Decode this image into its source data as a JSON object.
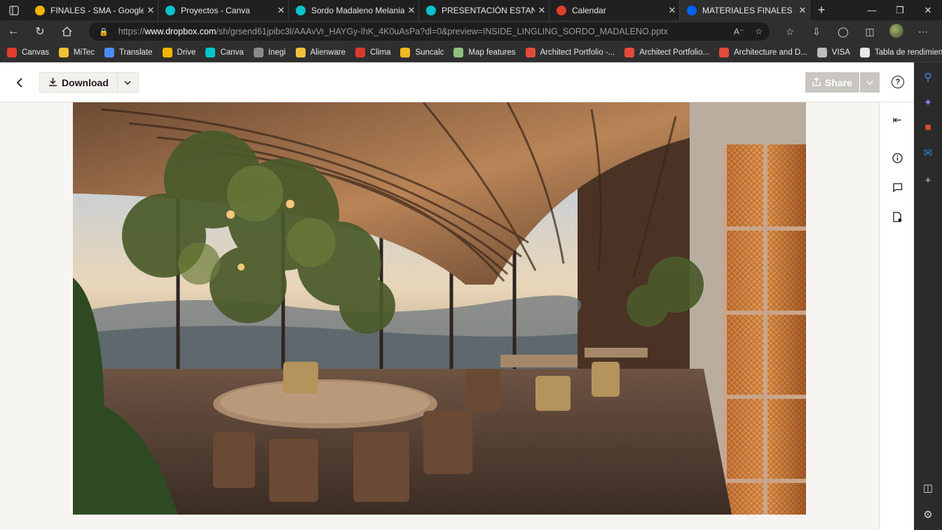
{
  "tabs": [
    {
      "title": "FINALES - SMA - Google Dr",
      "favicon": "google-drive-icon",
      "color": "#f4b400"
    },
    {
      "title": "Proyectos - Canva",
      "favicon": "canva-icon",
      "color": "#00c4cc"
    },
    {
      "title": "Sordo Madaleno Melania -",
      "favicon": "canva-icon",
      "color": "#00c4cc"
    },
    {
      "title": "PRESENTACIÓN ESTANCIA",
      "favicon": "canva-icon",
      "color": "#00c4cc"
    },
    {
      "title": "Calendar",
      "favicon": "calendar-icon",
      "color": "#e03e2d"
    },
    {
      "title": "MATERIALES FINALES - Dro",
      "favicon": "dropbox-icon",
      "color": "#0061fe",
      "active": true
    }
  ],
  "address": {
    "scheme": "https://",
    "host": "www.dropbox.com",
    "path": "/sh/grsend61jpibc3l/AAAvVr_HAYGy-IhK_4K0uAsPa?dl=0&preview=INSIDE_LINGLING_SORDO_MADALENO.pptx"
  },
  "bookmarks": [
    {
      "label": "Canvas",
      "icon": "canvas-icon",
      "color": "#e13f2b"
    },
    {
      "label": "MiTec",
      "icon": "bars-icon",
      "color": "#f2c230"
    },
    {
      "label": "Translate",
      "icon": "translate-icon",
      "color": "#4a8cf7"
    },
    {
      "label": "Drive",
      "icon": "google-drive-icon",
      "color": "#f4b400"
    },
    {
      "label": "Canva",
      "icon": "canva-icon",
      "color": "#00c4cc"
    },
    {
      "label": "Inegi",
      "icon": "inegi-icon",
      "color": "#8a8a8a"
    },
    {
      "label": "Alienware",
      "icon": "folder-icon",
      "color": "#f0c23b"
    },
    {
      "label": "Clima",
      "icon": "weather-icon",
      "color": "#d93a2b"
    },
    {
      "label": "Suncalc",
      "icon": "sun-icon",
      "color": "#f2b820"
    },
    {
      "label": "Map features",
      "icon": "map-icon",
      "color": "#8fbf7a"
    },
    {
      "label": "Architect Portfolio -...",
      "icon": "portfolio-icon",
      "color": "#e24a3b"
    },
    {
      "label": "Architect Portfolio...",
      "icon": "portfolio-icon",
      "color": "#e24a3b"
    },
    {
      "label": "Architecture and D...",
      "icon": "portfolio-icon",
      "color": "#e24a3b"
    },
    {
      "label": "VISA",
      "icon": "link-icon",
      "color": "#bdbdbd"
    },
    {
      "label": "Tabla de rendimient...",
      "icon": "document-icon",
      "color": "#e8e8e8"
    }
  ],
  "viewer": {
    "download_label": "Download",
    "share_label": "Share",
    "help_label": "?"
  },
  "colors": {
    "chrome_dark": "#202020",
    "dropbox_blue": "#0061fe",
    "share_disabled": "#c9c6c2"
  }
}
